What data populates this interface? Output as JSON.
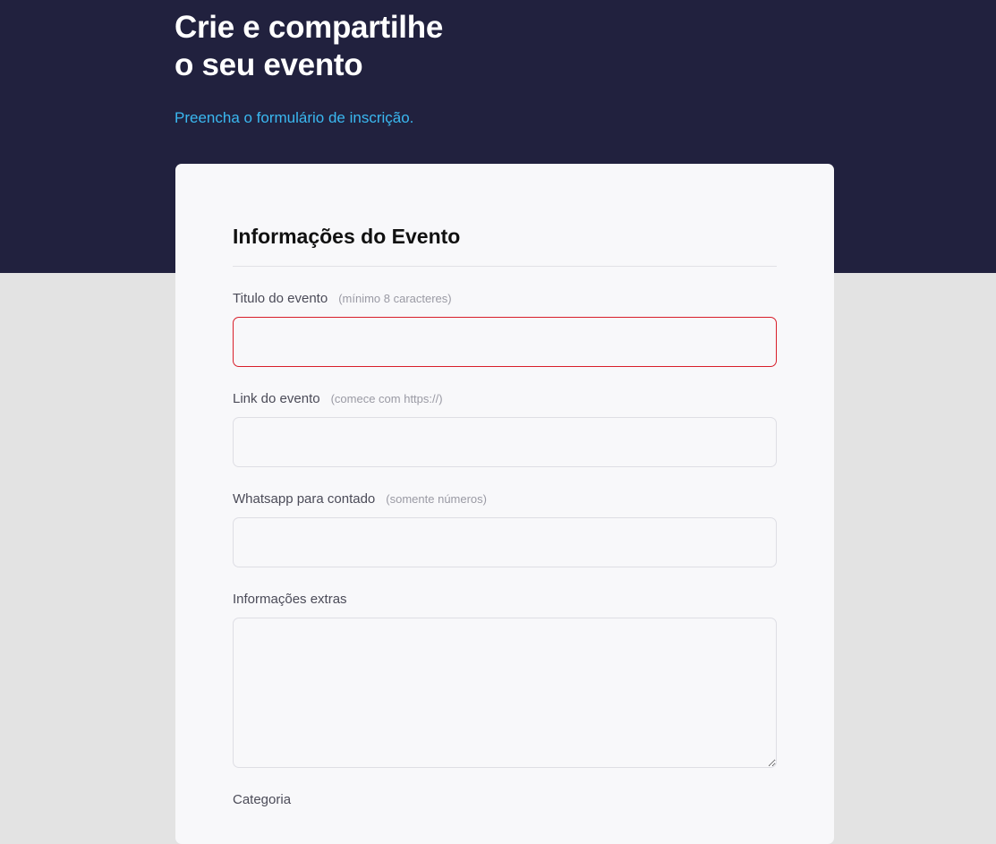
{
  "hero": {
    "title_line1": "Crie e compartilhe",
    "title_line2": "o seu evento",
    "subtitle": "Preencha o formulário de inscrição."
  },
  "form": {
    "section_title": "Informações do Evento",
    "fields": [
      {
        "label": "Titulo do evento",
        "hint": "(mínimo 8 caracteres)",
        "value": ""
      },
      {
        "label": "Link do evento",
        "hint": "(comece com https://)",
        "value": ""
      },
      {
        "label": "Whatsapp para contado",
        "hint": "(somente números)",
        "value": ""
      },
      {
        "label": "Informações extras",
        "value": ""
      },
      {
        "label": "Categoria"
      }
    ]
  },
  "colors": {
    "hero_bg": "#21213e",
    "accent": "#3ab8f0",
    "error_border": "#d81e2a",
    "page_bg": "#e3e3e3",
    "card_bg": "#f8f8fa"
  }
}
